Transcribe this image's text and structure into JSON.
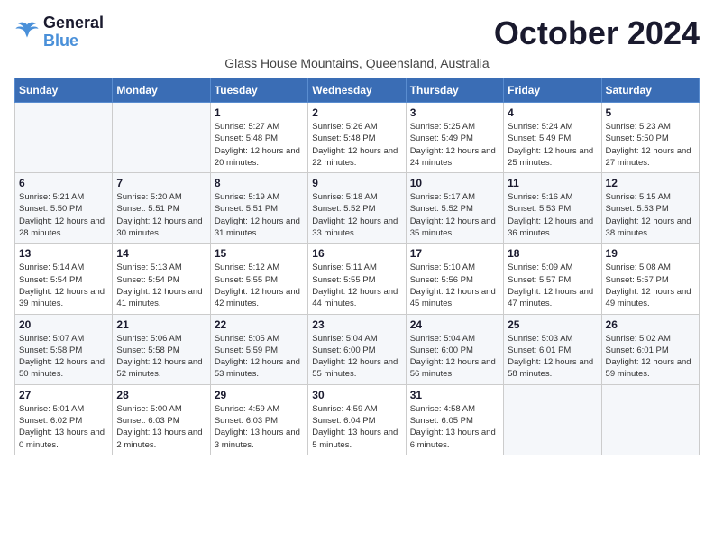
{
  "logo": {
    "line1": "General",
    "line2": "Blue"
  },
  "title": "October 2024",
  "subtitle": "Glass House Mountains, Queensland, Australia",
  "days_header": [
    "Sunday",
    "Monday",
    "Tuesday",
    "Wednesday",
    "Thursday",
    "Friday",
    "Saturday"
  ],
  "weeks": [
    [
      {
        "day": "",
        "info": ""
      },
      {
        "day": "",
        "info": ""
      },
      {
        "day": "1",
        "info": "Sunrise: 5:27 AM\nSunset: 5:48 PM\nDaylight: 12 hours and 20 minutes."
      },
      {
        "day": "2",
        "info": "Sunrise: 5:26 AM\nSunset: 5:48 PM\nDaylight: 12 hours and 22 minutes."
      },
      {
        "day": "3",
        "info": "Sunrise: 5:25 AM\nSunset: 5:49 PM\nDaylight: 12 hours and 24 minutes."
      },
      {
        "day": "4",
        "info": "Sunrise: 5:24 AM\nSunset: 5:49 PM\nDaylight: 12 hours and 25 minutes."
      },
      {
        "day": "5",
        "info": "Sunrise: 5:23 AM\nSunset: 5:50 PM\nDaylight: 12 hours and 27 minutes."
      }
    ],
    [
      {
        "day": "6",
        "info": "Sunrise: 5:21 AM\nSunset: 5:50 PM\nDaylight: 12 hours and 28 minutes."
      },
      {
        "day": "7",
        "info": "Sunrise: 5:20 AM\nSunset: 5:51 PM\nDaylight: 12 hours and 30 minutes."
      },
      {
        "day": "8",
        "info": "Sunrise: 5:19 AM\nSunset: 5:51 PM\nDaylight: 12 hours and 31 minutes."
      },
      {
        "day": "9",
        "info": "Sunrise: 5:18 AM\nSunset: 5:52 PM\nDaylight: 12 hours and 33 minutes."
      },
      {
        "day": "10",
        "info": "Sunrise: 5:17 AM\nSunset: 5:52 PM\nDaylight: 12 hours and 35 minutes."
      },
      {
        "day": "11",
        "info": "Sunrise: 5:16 AM\nSunset: 5:53 PM\nDaylight: 12 hours and 36 minutes."
      },
      {
        "day": "12",
        "info": "Sunrise: 5:15 AM\nSunset: 5:53 PM\nDaylight: 12 hours and 38 minutes."
      }
    ],
    [
      {
        "day": "13",
        "info": "Sunrise: 5:14 AM\nSunset: 5:54 PM\nDaylight: 12 hours and 39 minutes."
      },
      {
        "day": "14",
        "info": "Sunrise: 5:13 AM\nSunset: 5:54 PM\nDaylight: 12 hours and 41 minutes."
      },
      {
        "day": "15",
        "info": "Sunrise: 5:12 AM\nSunset: 5:55 PM\nDaylight: 12 hours and 42 minutes."
      },
      {
        "day": "16",
        "info": "Sunrise: 5:11 AM\nSunset: 5:55 PM\nDaylight: 12 hours and 44 minutes."
      },
      {
        "day": "17",
        "info": "Sunrise: 5:10 AM\nSunset: 5:56 PM\nDaylight: 12 hours and 45 minutes."
      },
      {
        "day": "18",
        "info": "Sunrise: 5:09 AM\nSunset: 5:57 PM\nDaylight: 12 hours and 47 minutes."
      },
      {
        "day": "19",
        "info": "Sunrise: 5:08 AM\nSunset: 5:57 PM\nDaylight: 12 hours and 49 minutes."
      }
    ],
    [
      {
        "day": "20",
        "info": "Sunrise: 5:07 AM\nSunset: 5:58 PM\nDaylight: 12 hours and 50 minutes."
      },
      {
        "day": "21",
        "info": "Sunrise: 5:06 AM\nSunset: 5:58 PM\nDaylight: 12 hours and 52 minutes."
      },
      {
        "day": "22",
        "info": "Sunrise: 5:05 AM\nSunset: 5:59 PM\nDaylight: 12 hours and 53 minutes."
      },
      {
        "day": "23",
        "info": "Sunrise: 5:04 AM\nSunset: 6:00 PM\nDaylight: 12 hours and 55 minutes."
      },
      {
        "day": "24",
        "info": "Sunrise: 5:04 AM\nSunset: 6:00 PM\nDaylight: 12 hours and 56 minutes."
      },
      {
        "day": "25",
        "info": "Sunrise: 5:03 AM\nSunset: 6:01 PM\nDaylight: 12 hours and 58 minutes."
      },
      {
        "day": "26",
        "info": "Sunrise: 5:02 AM\nSunset: 6:01 PM\nDaylight: 12 hours and 59 minutes."
      }
    ],
    [
      {
        "day": "27",
        "info": "Sunrise: 5:01 AM\nSunset: 6:02 PM\nDaylight: 13 hours and 0 minutes."
      },
      {
        "day": "28",
        "info": "Sunrise: 5:00 AM\nSunset: 6:03 PM\nDaylight: 13 hours and 2 minutes."
      },
      {
        "day": "29",
        "info": "Sunrise: 4:59 AM\nSunset: 6:03 PM\nDaylight: 13 hours and 3 minutes."
      },
      {
        "day": "30",
        "info": "Sunrise: 4:59 AM\nSunset: 6:04 PM\nDaylight: 13 hours and 5 minutes."
      },
      {
        "day": "31",
        "info": "Sunrise: 4:58 AM\nSunset: 6:05 PM\nDaylight: 13 hours and 6 minutes."
      },
      {
        "day": "",
        "info": ""
      },
      {
        "day": "",
        "info": ""
      }
    ]
  ]
}
